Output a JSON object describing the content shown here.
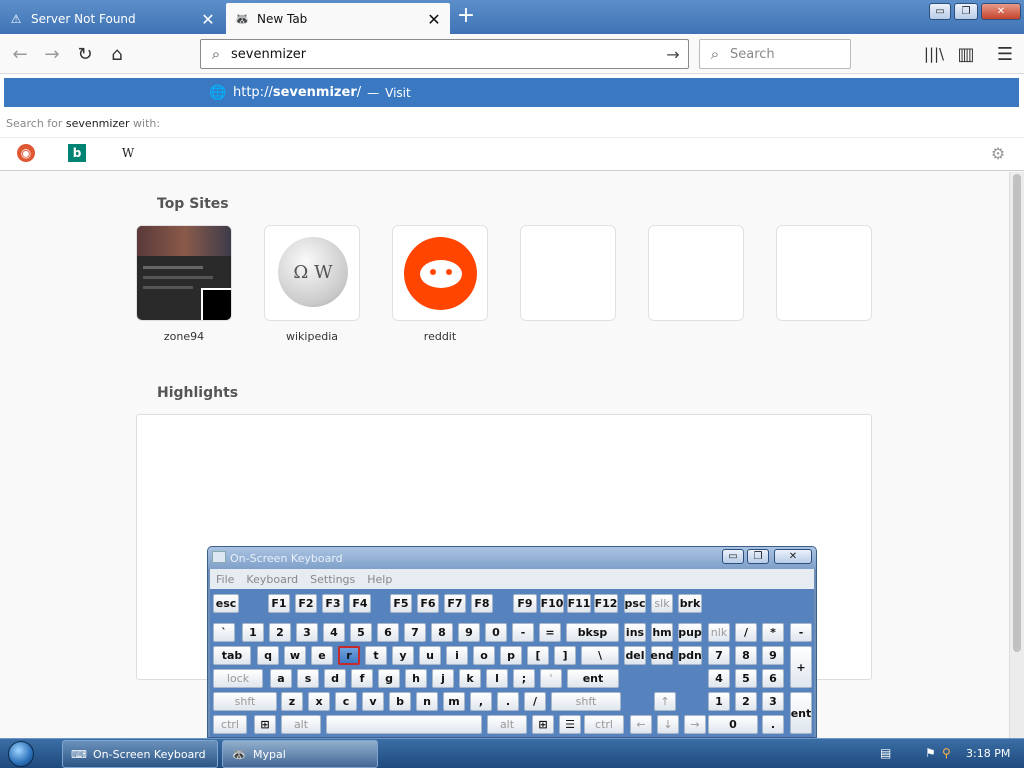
{
  "tabs": [
    {
      "title": "Server Not Found",
      "icon": "warning-icon",
      "close": "✕"
    },
    {
      "title": "New Tab",
      "icon": "mypal-icon",
      "close": "✕"
    }
  ],
  "newtab_label": "+",
  "window": {
    "minimize": "▭",
    "restore": "❐",
    "close": "✕"
  },
  "nav": {
    "back": "←",
    "forward": "→",
    "reload": "↻",
    "home": "⌂"
  },
  "urlbar": {
    "value": "sevenmizer",
    "go": "→"
  },
  "searchbar": {
    "placeholder": "Search"
  },
  "suggestion": {
    "url_prefix": "http://",
    "url_bold": "sevenmizer",
    "url_suffix": "/",
    "separator": "—",
    "action": "Visit"
  },
  "search_for": {
    "prefix": "Search for",
    "term": "sevenmizer",
    "suffix": "with:"
  },
  "engines": [
    {
      "name": "duckduckgo-icon",
      "glyph": "◉"
    },
    {
      "name": "bing-icon",
      "glyph": "b"
    },
    {
      "name": "wikipedia-icon",
      "glyph": "W"
    }
  ],
  "top_sites": {
    "heading": "Top Sites",
    "sites": [
      {
        "label": "zone94",
        "icon": "zone94-thumbnail"
      },
      {
        "label": "wikipedia",
        "icon": "wikipedia-globe-icon"
      },
      {
        "label": "reddit",
        "icon": "reddit-alien-icon"
      },
      {
        "label": ""
      },
      {
        "label": ""
      },
      {
        "label": ""
      }
    ]
  },
  "highlights": {
    "heading": "Highlights"
  },
  "osk": {
    "title": "On-Screen Keyboard",
    "menu": [
      "File",
      "Keyboard",
      "Settings",
      "Help"
    ],
    "rows": {
      "r1": [
        "esc",
        "F1",
        "F2",
        "F3",
        "F4",
        "F5",
        "F6",
        "F7",
        "F8",
        "F9",
        "F10",
        "F11",
        "F12",
        "psc",
        "slk",
        "brk"
      ],
      "r2": [
        "`",
        "1",
        "2",
        "3",
        "4",
        "5",
        "6",
        "7",
        "8",
        "9",
        "0",
        "-",
        "=",
        "bksp",
        "ins",
        "hm",
        "pup",
        "nlk",
        "/",
        "*",
        "-"
      ],
      "r3": [
        "tab",
        "q",
        "w",
        "e",
        "r",
        "t",
        "y",
        "u",
        "i",
        "o",
        "p",
        "[",
        "]",
        "\\",
        "del",
        "end",
        "pdn",
        "7",
        "8",
        "9",
        "+"
      ],
      "r4": [
        "lock",
        "a",
        "s",
        "d",
        "f",
        "g",
        "h",
        "j",
        "k",
        "l",
        ";",
        "'",
        "ent",
        "4",
        "5",
        "6"
      ],
      "r5": [
        "shft",
        "z",
        "x",
        "c",
        "v",
        "b",
        "n",
        "m",
        ",",
        ".",
        "/",
        "shft",
        "↑",
        "1",
        "2",
        "3",
        "ent"
      ],
      "r6": [
        "ctrl",
        "⊞",
        "alt",
        "",
        "alt",
        "⊞",
        "☰",
        "ctrl",
        "←",
        "↓",
        "→",
        "0",
        "."
      ]
    }
  },
  "taskbar": {
    "items": [
      {
        "label": "On-Screen Keyboard",
        "icon": "keyboard-icon"
      },
      {
        "label": "Mypal",
        "icon": "mypal-icon"
      }
    ],
    "time": "3:18 PM"
  }
}
